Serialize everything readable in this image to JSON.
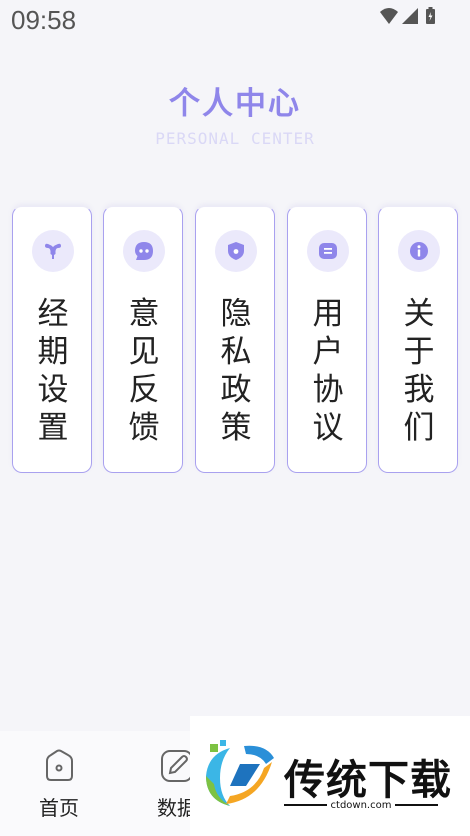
{
  "status_bar": {
    "time": "09:58",
    "icons": [
      "wifi-icon",
      "signal-icon",
      "battery-icon"
    ]
  },
  "header": {
    "title": "个人中心",
    "subtitle": "PERSONAL CENTER"
  },
  "menu_cards": [
    {
      "icon": "uterus-icon",
      "label": [
        "经",
        "期",
        "设",
        "置"
      ]
    },
    {
      "icon": "chat-icon",
      "label": [
        "意",
        "见",
        "反",
        "馈"
      ]
    },
    {
      "icon": "shield-icon",
      "label": [
        "隐",
        "私",
        "政",
        "策"
      ]
    },
    {
      "icon": "document-icon",
      "label": [
        "用",
        "户",
        "协",
        "议"
      ]
    },
    {
      "icon": "info-icon",
      "label": [
        "关",
        "于",
        "我",
        "们"
      ]
    }
  ],
  "bottom_nav": [
    {
      "icon": "home-icon",
      "label": "首页"
    },
    {
      "icon": "edit-icon",
      "label": "数据"
    }
  ],
  "watermark": {
    "brand": "传统下载",
    "url": "ctdown.com"
  },
  "colors": {
    "accent": "#8f86ea",
    "accent_light": "#ebe9fb",
    "background": "#f5f5f9"
  }
}
